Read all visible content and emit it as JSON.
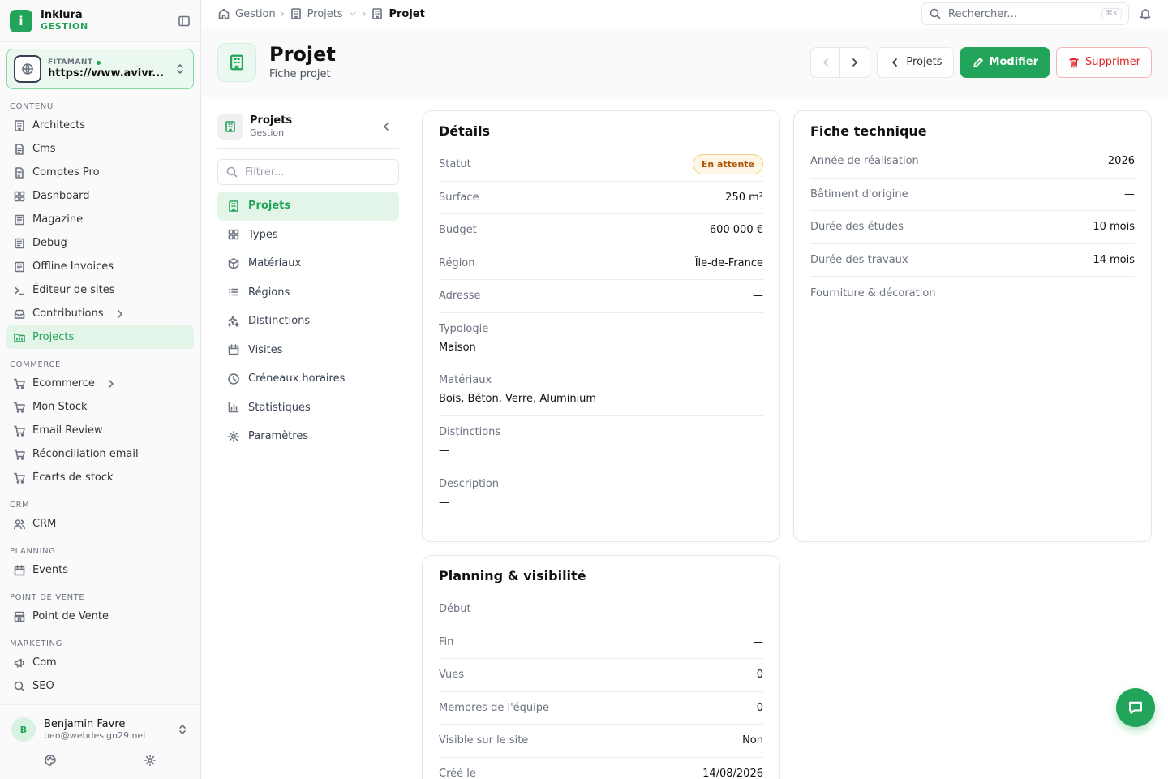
{
  "brand": {
    "name": "Inklura",
    "sub": "GESTION"
  },
  "site": {
    "label": "FITAMANT",
    "url": "https://www.avivr..."
  },
  "sidebar": {
    "sections": [
      {
        "title": "CONTENU",
        "items": [
          {
            "label": "Architects",
            "icon": "building-icon"
          },
          {
            "label": "Cms",
            "icon": "file-icon"
          },
          {
            "label": "Comptes Pro",
            "icon": "file-icon"
          },
          {
            "label": "Dashboard",
            "icon": "grid-icon"
          },
          {
            "label": "Magazine",
            "icon": "newspaper-icon"
          },
          {
            "label": "Debug",
            "icon": "newspaper-icon"
          },
          {
            "label": "Offline Invoices",
            "icon": "newspaper-icon"
          },
          {
            "label": "Éditeur de sites",
            "icon": "terminal-icon"
          },
          {
            "label": "Contributions",
            "icon": "inbox-icon",
            "chevron": true
          },
          {
            "label": "Projects",
            "icon": "folder-icon",
            "active": true
          }
        ]
      },
      {
        "title": "COMMERCE",
        "items": [
          {
            "label": "Ecommerce",
            "icon": "cart-icon",
            "chevron": true
          },
          {
            "label": "Mon Stock",
            "icon": "cart-icon"
          },
          {
            "label": "Email Review",
            "icon": "cart-icon"
          },
          {
            "label": "Réconciliation email",
            "icon": "cart-icon"
          },
          {
            "label": "Écarts de stock",
            "icon": "cart-icon"
          }
        ]
      },
      {
        "title": "CRM",
        "items": [
          {
            "label": "CRM",
            "icon": "users-icon"
          }
        ]
      },
      {
        "title": "PLANNING",
        "items": [
          {
            "label": "Events",
            "icon": "calendar-icon"
          }
        ]
      },
      {
        "title": "POINT DE VENTE",
        "items": [
          {
            "label": "Point de Vente",
            "icon": "store-icon"
          }
        ]
      },
      {
        "title": "MARKETING",
        "items": [
          {
            "label": "Com",
            "icon": "megaphone-icon"
          },
          {
            "label": "SEO",
            "icon": "search-icon"
          }
        ]
      }
    ]
  },
  "user": {
    "initial": "B",
    "name": "Benjamin Favre",
    "email": "ben@webdesign29.net"
  },
  "breadcrumb": {
    "home": "Gestion",
    "parent": "Projets",
    "current": "Projet"
  },
  "search": {
    "placeholder": "Rechercher...",
    "shortcut": "⌘K"
  },
  "header": {
    "title": "Projet",
    "subtitle": "Fiche projet",
    "back_label": "Projets",
    "edit_label": "Modifier",
    "delete_label": "Supprimer"
  },
  "subnav": {
    "title": "Projets",
    "subtitle": "Gestion",
    "filter_placeholder": "Filtrer...",
    "items": [
      {
        "label": "Projets",
        "icon": "building-icon",
        "active": true
      },
      {
        "label": "Types",
        "icon": "grid-icon"
      },
      {
        "label": "Matériaux",
        "icon": "box-icon"
      },
      {
        "label": "Régions",
        "icon": "list-icon"
      },
      {
        "label": "Distinctions",
        "icon": "sparkles-icon"
      },
      {
        "label": "Visites",
        "icon": "calendar-icon"
      },
      {
        "label": "Créneaux horaires",
        "icon": "clock-icon"
      },
      {
        "label": "Statistiques",
        "icon": "chart-icon"
      },
      {
        "label": "Paramètres",
        "icon": "gear-icon"
      }
    ]
  },
  "details": {
    "title": "Détails",
    "rows": [
      {
        "label": "Statut",
        "badge": "En attente"
      },
      {
        "label": "Surface",
        "value": "250 m²"
      },
      {
        "label": "Budget",
        "value": "600 000 €"
      },
      {
        "label": "Région",
        "value": "Île-de-France"
      },
      {
        "label": "Adresse",
        "value": "—"
      },
      {
        "label": "Typologie",
        "value": "Maison",
        "block": true
      },
      {
        "label": "Matériaux",
        "value": "Bois, Béton, Verre, Aluminium",
        "block": true
      },
      {
        "label": "Distinctions",
        "value": "—",
        "block": true
      },
      {
        "label": "Description",
        "value": "—",
        "block": true
      }
    ]
  },
  "technical": {
    "title": "Fiche technique",
    "rows": [
      {
        "label": "Année de réalisation",
        "value": "2026"
      },
      {
        "label": "Bâtiment d'origine",
        "value": "—"
      },
      {
        "label": "Durée des études",
        "value": "10 mois"
      },
      {
        "label": "Durée des travaux",
        "value": "14 mois"
      },
      {
        "label": "Fourniture & décoration",
        "value": "—",
        "block": true
      }
    ]
  },
  "planning": {
    "title": "Planning & visibilité",
    "rows": [
      {
        "label": "Début",
        "value": "—"
      },
      {
        "label": "Fin",
        "value": "—"
      },
      {
        "label": "Vues",
        "value": "0"
      },
      {
        "label": "Membres de l'équipe",
        "value": "0"
      },
      {
        "label": "Visible sur le site",
        "value": "Non"
      },
      {
        "label": "Créé le",
        "value": "14/08/2026"
      }
    ]
  },
  "colors": {
    "accent": "#22a55a",
    "danger": "#dc2626",
    "warning": "#b45309"
  }
}
